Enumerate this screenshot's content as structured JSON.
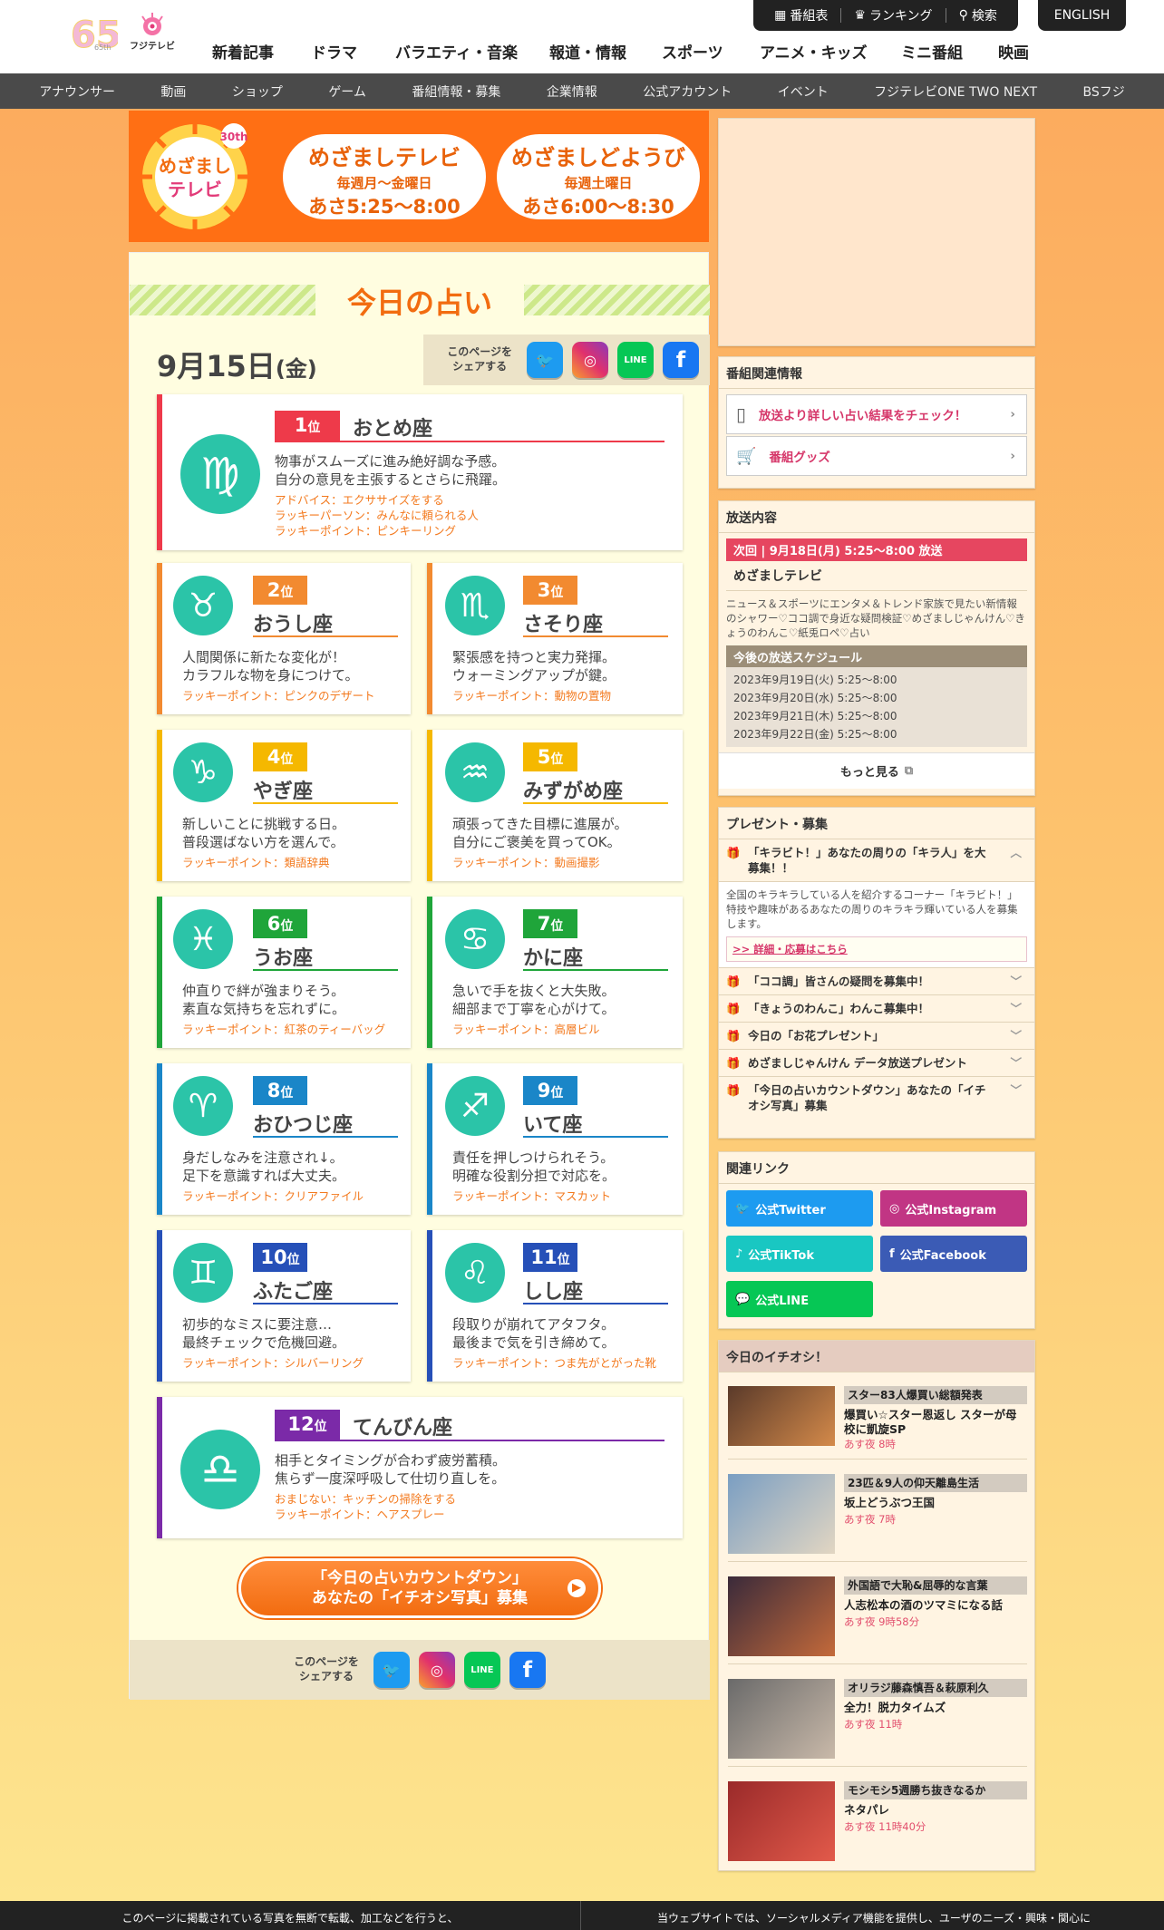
{
  "header": {
    "logo_65": "65th",
    "logo_fuji": "フジテレビ",
    "util": [
      "番組表",
      "ランキング",
      "検索"
    ],
    "english": "ENGLISH",
    "nav": [
      "新着記事",
      "ドラマ",
      "バラエティ・音楽",
      "報道・情報",
      "スポーツ",
      "アニメ・キッズ",
      "ミニ番組",
      "映画"
    ],
    "subnav": [
      "アナウンサー",
      "動画",
      "ショップ",
      "ゲーム",
      "番組情報・募集",
      "企業情報",
      "公式アカウント",
      "イベント",
      "フジテレビONE TWO NEXT",
      "BSフジ"
    ]
  },
  "banner": {
    "logo": "めざましテレビ",
    "anniv": "30th",
    "p1_title": "めざましテレビ",
    "p1_days": "毎週月〜金曜日",
    "p1_time": "あさ5:25〜8:00",
    "p2_title": "めざましどようび",
    "p2_days": "毎週土曜日",
    "p2_time": "あさ6:00〜8:30"
  },
  "fortune": {
    "title": "今日の占い",
    "date_md": "9月15日",
    "date_wd": "(金)",
    "share_label_1": "このページを",
    "share_label_2": "シェアする",
    "rank_unit": "位",
    "cards": [
      {
        "rank": "1",
        "sign": "おとめ座",
        "glyph": "♍",
        "desc1": "物事がスムーズに進み絶好調な予感。",
        "desc2": "自分の意見を主張するとさらに飛躍。",
        "l1": "アドバイス：エクササイズをする",
        "l2": "ラッキーパーソン：みんなに頼られる人",
        "l3": "ラッキーポイント：ピンキーリング",
        "color": "#ee3a4a"
      },
      {
        "rank": "2",
        "sign": "おうし座",
        "glyph": "♉",
        "desc1": "人間関係に新たな変化が！",
        "desc2": "カラフルな物を身につけて。",
        "l1": "ラッキーポイント：ピンクのデザート",
        "color": "#f28a30"
      },
      {
        "rank": "3",
        "sign": "さそり座",
        "glyph": "♏",
        "desc1": "緊張感を持つと実力発揮。",
        "desc2": "ウォーミングアップが鍵。",
        "l1": "ラッキーポイント：動物の置物",
        "color": "#f28a30"
      },
      {
        "rank": "4",
        "sign": "やぎ座",
        "glyph": "♑",
        "desc1": "新しいことに挑戦する日。",
        "desc2": "普段選ばない方を選んで。",
        "l1": "ラッキーポイント：類語辞典",
        "color": "#f5b800"
      },
      {
        "rank": "5",
        "sign": "みずがめ座",
        "glyph": "♒",
        "desc1": "頑張ってきた目標に進展が。",
        "desc2": "自分にご褒美を買ってOK。",
        "l1": "ラッキーポイント：動画撮影",
        "color": "#f5b800"
      },
      {
        "rank": "6",
        "sign": "うお座",
        "glyph": "♓",
        "desc1": "仲直りで絆が強まりそう。",
        "desc2": "素直な気持ちを忘れずに。",
        "l1": "ラッキーポイント：紅茶のティーバッグ",
        "color": "#1fa53a"
      },
      {
        "rank": "7",
        "sign": "かに座",
        "glyph": "♋",
        "desc1": "急いで手を抜くと大失敗。",
        "desc2": "細部まで丁寧を心がけて。",
        "l1": "ラッキーポイント：高層ビル",
        "color": "#1fa53a"
      },
      {
        "rank": "8",
        "sign": "おひつじ座",
        "glyph": "♈",
        "desc1": "身だしなみを注意され↓。",
        "desc2": "足下を意識すれば大丈夫。",
        "l1": "ラッキーポイント：クリアファイル",
        "color": "#1a86c8"
      },
      {
        "rank": "9",
        "sign": "いて座",
        "glyph": "♐",
        "desc1": "責任を押しつけられそう。",
        "desc2": "明確な役割分担で対応を。",
        "l1": "ラッキーポイント：マスカット",
        "color": "#1a86c8"
      },
      {
        "rank": "10",
        "sign": "ふたご座",
        "glyph": "♊",
        "desc1": "初歩的なミスに要注意…",
        "desc2": "最終チェックで危機回避。",
        "l1": "ラッキーポイント：シルバーリング",
        "color": "#2650b8"
      },
      {
        "rank": "11",
        "sign": "しし座",
        "glyph": "♌",
        "desc1": "段取りが崩れてアタフタ。",
        "desc2": "最後まで気を引き締めて。",
        "l1": "ラッキーポイント：つま先がとがった靴",
        "color": "#2650b8"
      },
      {
        "rank": "12",
        "sign": "てんびん座",
        "glyph": "♎",
        "desc1": "相手とタイミングが合わず疲労蓄積。",
        "desc2": "焦らず一度深呼吸して仕切り直しを。",
        "l1": "おまじない：キッチンの掃除をする",
        "l2": "ラッキーポイント：ヘアスプレー",
        "color": "#7b2aa8"
      }
    ],
    "cta_line1": "「今日の占いカウントダウン」",
    "cta_line2": "あなたの「イチオシ写真」募集"
  },
  "sidebar": {
    "related_title": "番組関連情報",
    "related_links": [
      "放送より詳しい占い結果をチェック！",
      "番組グッズ"
    ],
    "broadcast_title": "放送内容",
    "next_ribbon": "次回 | 9月18日(月) 5:25〜8:00 放送",
    "program_name": "めざましテレビ",
    "program_desc": "ニュース＆スポーツにエンタメ＆トレンド家族で見たい新情報のシャワー♡ココ調で身近な疑問検証♡めざましじゃんけん♡きょうのわんこ♡紙兎ロペ♡占い",
    "schedule_title": "今後の放送スケジュール",
    "schedule": [
      "2023年9月19日(火) 5:25〜8:00",
      "2023年9月20日(水) 5:25〜8:00",
      "2023年9月21日(木) 5:25〜8:00",
      "2023年9月22日(金) 5:25〜8:00"
    ],
    "more": "もっと見る",
    "present_title": "プレゼント・募集",
    "present_open_title": "「キラビト！」あなたの周りの「キラ人」を大募集！！",
    "present_open_desc1": "全国のキラキラしている人を紹介するコーナー「キラビト！」",
    "present_open_desc2": "特技や趣味があるあなたの周りのキラキラ輝いている人を募集します。",
    "present_detail_link": ">> 詳細・応募はこちら",
    "present_items": [
      "「ココ調」皆さんの疑問を募集中！",
      "「きょうのわんこ」わんこ募集中！",
      "今日の「お花プレゼント」",
      "めざましじゃんけん データ放送プレゼント",
      "「今日の占いカウントダウン」あなたの「イチオシ写真」募集"
    ],
    "links_title": "関連リンク",
    "social_links": [
      {
        "label": "公式Twitter",
        "color": "#1d9bf0"
      },
      {
        "label": "公式Instagram",
        "color": "#c13584"
      },
      {
        "label": "公式TikTok",
        "color": "#19c7c2"
      },
      {
        "label": "公式Facebook",
        "color": "#3b5bb5"
      },
      {
        "label": "公式LINE",
        "color": "#06c755"
      }
    ],
    "pick_title": "今日のイチオシ！",
    "picks": [
      {
        "tag": "スター83人爆買い総額発表",
        "title": "爆買い☆スター恩返し スターが母校に凱旋SP",
        "time": "あす夜 8時"
      },
      {
        "tag": "23匹＆9人の仰天離島生活",
        "title": "坂上どうぶつ王国",
        "time": "あす夜 7時"
      },
      {
        "tag": "外国語で大恥&屈辱的な言葉",
        "title": "人志松本の酒のツマミになる話",
        "time": "あす夜 9時58分"
      },
      {
        "tag": "オリラジ藤森慎吾＆萩原利久",
        "title": "全力！脱力タイムズ",
        "time": "あす夜 11時"
      },
      {
        "tag": "モシモシ5週勝ち抜きなるか",
        "title": "ネタパレ",
        "time": "あす夜 11時40分"
      }
    ]
  },
  "footer": {
    "left": "このページに掲載されている写真を無断で転載、加工などを行うと、",
    "right": "当ウェブサイトでは、ソーシャルメディア機能を提供し、ユーザのニーズ・興味・関心に"
  }
}
